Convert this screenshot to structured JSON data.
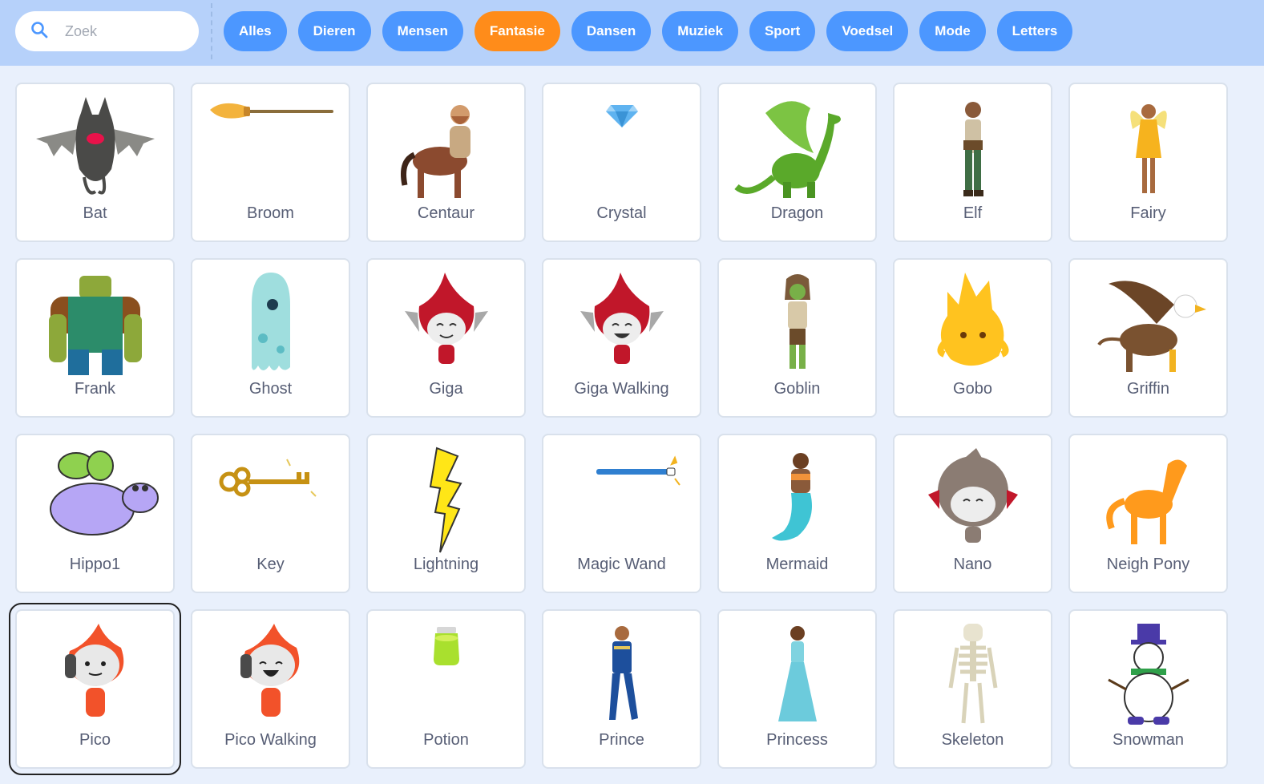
{
  "search": {
    "placeholder": "Zoek"
  },
  "tags": [
    {
      "label": "Alles",
      "active": false
    },
    {
      "label": "Dieren",
      "active": false
    },
    {
      "label": "Mensen",
      "active": false
    },
    {
      "label": "Fantasie",
      "active": true
    },
    {
      "label": "Dansen",
      "active": false
    },
    {
      "label": "Muziek",
      "active": false
    },
    {
      "label": "Sport",
      "active": false
    },
    {
      "label": "Voedsel",
      "active": false
    },
    {
      "label": "Mode",
      "active": false
    },
    {
      "label": "Letters",
      "active": false
    }
  ],
  "colors": {
    "accent": "#4c97ff",
    "active_tag": "#ff8c1a",
    "topbar": "#b6d1fa",
    "background": "#e9f0fc",
    "label": "#575e75"
  },
  "sprites": [
    {
      "name": "Bat",
      "icon": "bat-icon"
    },
    {
      "name": "Broom",
      "icon": "broom-icon"
    },
    {
      "name": "Centaur",
      "icon": "centaur-icon"
    },
    {
      "name": "Crystal",
      "icon": "crystal-icon"
    },
    {
      "name": "Dragon",
      "icon": "dragon-icon"
    },
    {
      "name": "Elf",
      "icon": "elf-icon"
    },
    {
      "name": "Fairy",
      "icon": "fairy-icon"
    },
    {
      "name": "Frank",
      "icon": "frank-icon"
    },
    {
      "name": "Ghost",
      "icon": "ghost-icon"
    },
    {
      "name": "Giga",
      "icon": "giga-icon"
    },
    {
      "name": "Giga Walking",
      "icon": "giga-walking-icon"
    },
    {
      "name": "Goblin",
      "icon": "goblin-icon"
    },
    {
      "name": "Gobo",
      "icon": "gobo-icon"
    },
    {
      "name": "Griffin",
      "icon": "griffin-icon"
    },
    {
      "name": "Hippo1",
      "icon": "hippo-icon"
    },
    {
      "name": "Key",
      "icon": "key-icon"
    },
    {
      "name": "Lightning",
      "icon": "lightning-icon"
    },
    {
      "name": "Magic Wand",
      "icon": "magic-wand-icon"
    },
    {
      "name": "Mermaid",
      "icon": "mermaid-icon"
    },
    {
      "name": "Nano",
      "icon": "nano-icon"
    },
    {
      "name": "Neigh Pony",
      "icon": "pony-icon"
    },
    {
      "name": "Pico",
      "icon": "pico-icon",
      "selected": true
    },
    {
      "name": "Pico Walking",
      "icon": "pico-walking-icon"
    },
    {
      "name": "Potion",
      "icon": "potion-icon"
    },
    {
      "name": "Prince",
      "icon": "prince-icon"
    },
    {
      "name": "Princess",
      "icon": "princess-icon"
    },
    {
      "name": "Skeleton",
      "icon": "skeleton-icon"
    },
    {
      "name": "Snowman",
      "icon": "snowman-icon"
    }
  ]
}
